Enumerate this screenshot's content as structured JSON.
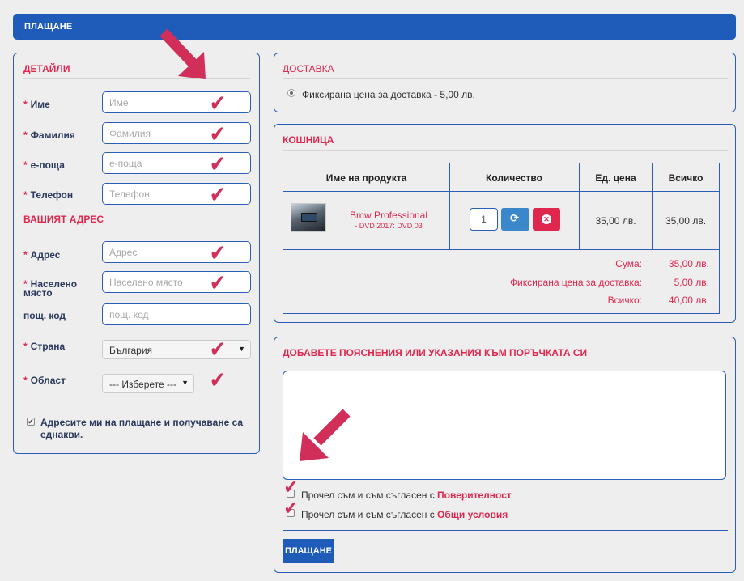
{
  "header": {
    "title": "ПЛАЩАНЕ"
  },
  "details": {
    "title": "ДЕТАЙЛИ",
    "first_name": {
      "label": "Име",
      "placeholder": "Име"
    },
    "last_name": {
      "label": "Фамилия",
      "placeholder": "Фамилия"
    },
    "email": {
      "label": "е-поща",
      "placeholder": "е-поща"
    },
    "phone": {
      "label": "Телефон",
      "placeholder": "Телефон"
    }
  },
  "address": {
    "title": "ВАШИЯТ АДРЕС",
    "street": {
      "label": "Адрес",
      "placeholder": "Адрес"
    },
    "city": {
      "label": "Населено място",
      "placeholder": "Населено място"
    },
    "zip": {
      "label": "пощ. код",
      "placeholder": "пощ. код"
    },
    "country": {
      "label": "Страна",
      "value": "България"
    },
    "region": {
      "label": "Област",
      "value": "--- Изберете ---"
    },
    "same_address": {
      "label": "Адресите ми на плащане и получаване са еднакви.",
      "checked": true
    },
    "required_mark": "*"
  },
  "delivery": {
    "title": "ДОСТАВКА",
    "option": "Фиксирана цена за доставка - 5,00 лв."
  },
  "cart": {
    "title": "КОШНИЦА",
    "columns": [
      "Име на продукта",
      "Количество",
      "Ед. цена",
      "Всичко"
    ],
    "item": {
      "name": "Bmw Professional",
      "variant": "- DVD 2017: DVD 03",
      "quantity": "1",
      "unit_price": "35,00 лв.",
      "total": "35,00 лв."
    },
    "summary": [
      {
        "label": "Сума:",
        "value": "35,00 лв."
      },
      {
        "label": "Фиксирана цена за доставка:",
        "value": "5,00 лв."
      },
      {
        "label": "Всичко:",
        "value": "40,00 лв."
      }
    ]
  },
  "notes": {
    "title": "ДОБАВЕТЕ ПОЯСНЕНИЯ ИЛИ УКАЗАНИЯ КЪМ ПОРЪЧКАТА СИ",
    "text": "",
    "privacy_prefix": "Прочел съм и съм съгласен с ",
    "privacy_link": "Поверителност",
    "terms_prefix": "Прочел съм и съм съгласен с ",
    "terms_link": "Общи условия"
  },
  "pay_button": "ПЛАЩАНЕ",
  "colors": {
    "brand_blue": "#1f5bb8",
    "accent_red": "#e0284f",
    "arrow_pink": "#d22e5a",
    "refresh_button": "#3a87c9"
  },
  "icons": {
    "tick": "checkmark-icon",
    "arrow": "pointer-arrow-icon",
    "refresh": "refresh-icon",
    "remove": "remove-icon",
    "dropdown": "chevron-down-icon"
  }
}
